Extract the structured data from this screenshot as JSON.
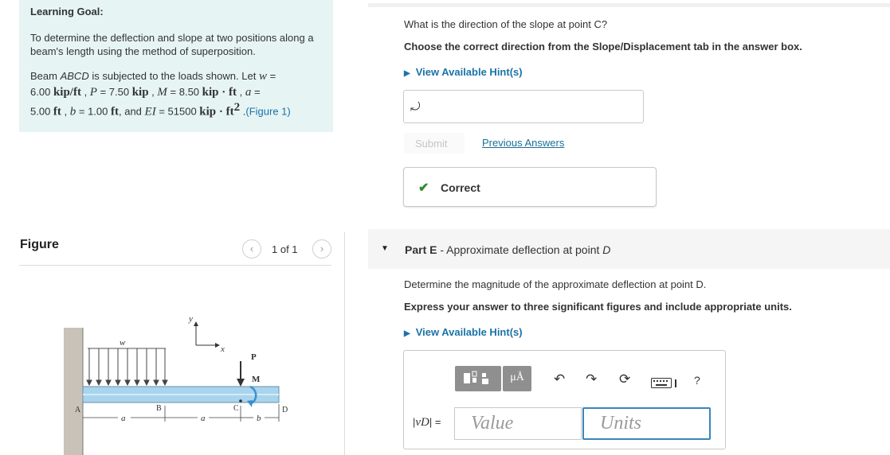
{
  "learning_goal": {
    "title": "Learning Goal:",
    "description": "To determine the deflection and slope at two positions along a beam's length using the method of superposition.",
    "beam_intro": "Beam",
    "beam_name": "ABCD",
    "beam_text": "is subjected to the loads shown. Let",
    "w_label": "w",
    "w_eq": " = ",
    "w_value": "6.00",
    "w_unit": "kip/ft",
    "p_label": "P",
    "p_value": " = 7.50 ",
    "p_unit": "kip",
    "m_label": "M",
    "m_value": " = 8.50 ",
    "m_unit": "kip · ft",
    "a_label": "a",
    "a_eq": " =",
    "a_value": "5.00 ",
    "a_unit": "ft",
    "b_label": "b",
    "b_value": " = 1.00 ",
    "b_unit": "ft",
    "and_text": ", and ",
    "ei_label": "EI",
    "ei_value": " = 51500 ",
    "ei_unit": "kip · ft",
    "ei_exp": "2",
    "figure_link": "(Figure 1)"
  },
  "figure_panel": {
    "label": "Figure",
    "pager_text": "1 of 1",
    "prev_icon": "‹",
    "next_icon": "›",
    "diagram_labels": {
      "w": "w",
      "y": "y",
      "x": "x",
      "P": "P",
      "M": "M",
      "A": "A",
      "B": "B",
      "C": "C",
      "D": "D",
      "a1": "a",
      "a2": "a",
      "b": "b"
    }
  },
  "part_d": {
    "question": "What is the direction of the slope at point C?",
    "instruction": "Choose the correct direction from the Slope/Displacement tab in the answer box.",
    "hint_label": "View Available Hint(s)",
    "answer_glyph": "⤾",
    "submit_label": "Submit",
    "previous_answers_label": "Previous Answers",
    "feedback": "Correct",
    "feedback_color": "#2e8b2e"
  },
  "part_e": {
    "part_label": "Part E",
    "part_sep": " - ",
    "part_title": "Approximate deflection at point ",
    "part_point": "D",
    "determine": "Determine the magnitude of the approximate deflection at point D.",
    "express": "Express your answer to three significant figures and include appropriate units.",
    "hint_label": "View Available Hint(s)",
    "answer_label_left": "|",
    "answer_var": "vD",
    "answer_label_right": "| =",
    "value_placeholder": "Value",
    "units_placeholder": "Units",
    "toolbar": {
      "units_button": "μÅ",
      "undo_icon": "↶",
      "redo_icon": "↷",
      "reset_icon": "⟳",
      "help_icon": "?"
    }
  },
  "colors": {
    "goal_background": "#e6f4f4",
    "link": "#1a73a8",
    "toolbar_button": "#8f8f8f",
    "units_focus_border": "#3a85bd",
    "beam_fill": "#a8d4ee"
  }
}
